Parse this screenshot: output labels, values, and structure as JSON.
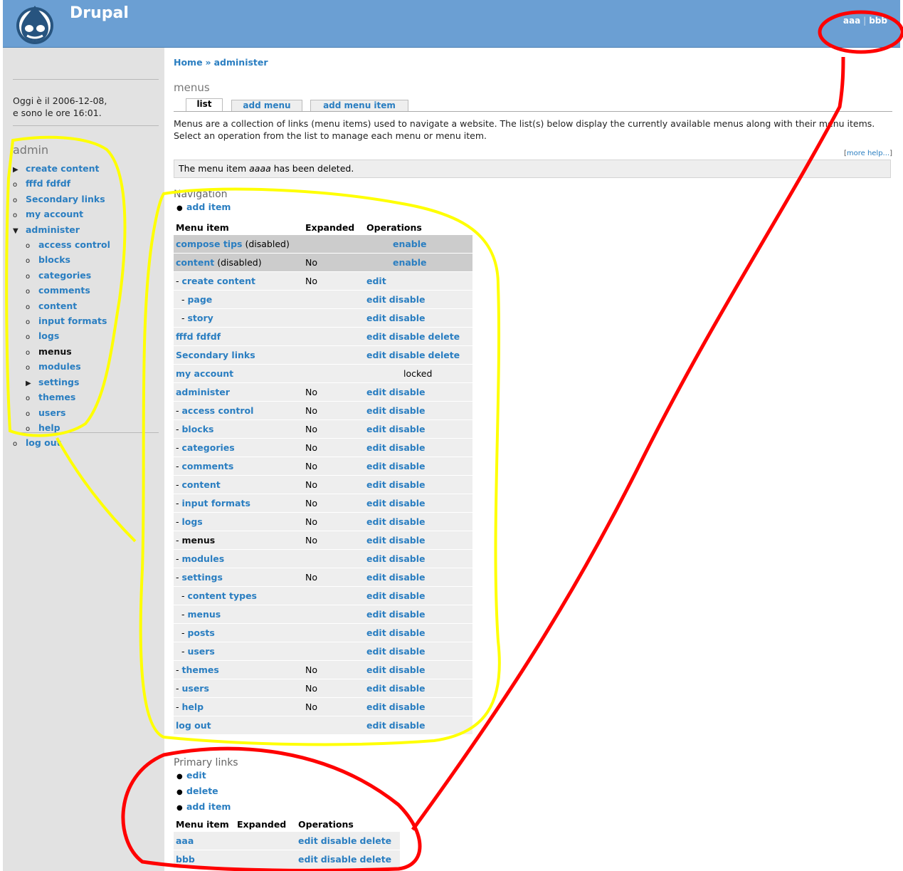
{
  "header": {
    "site_name": "Drupal",
    "secondary_links": [
      {
        "label": "aaa"
      },
      {
        "label": "bbb"
      }
    ],
    "logo_icon": "drupal-drop-logo-icon"
  },
  "sidebar": {
    "date_line1": "Oggi è il 2006-12-08,",
    "date_line2": "e sono le ore 16:01.",
    "user_title": "admin",
    "items": [
      {
        "label": "create content",
        "bullet": "▶",
        "level": 0
      },
      {
        "label": "fffd fdfdf",
        "bullet": "o",
        "level": 0
      },
      {
        "label": "Secondary links",
        "bullet": "o",
        "level": 0
      },
      {
        "label": "my account",
        "bullet": "o",
        "level": 0
      },
      {
        "label": "administer",
        "bullet": "▼",
        "level": 0
      },
      {
        "label": "access control",
        "bullet": "o",
        "level": 1
      },
      {
        "label": "blocks",
        "bullet": "o",
        "level": 1
      },
      {
        "label": "categories",
        "bullet": "o",
        "level": 1
      },
      {
        "label": "comments",
        "bullet": "o",
        "level": 1
      },
      {
        "label": "content",
        "bullet": "o",
        "level": 1
      },
      {
        "label": "input formats",
        "bullet": "o",
        "level": 1
      },
      {
        "label": "logs",
        "bullet": "o",
        "level": 1
      },
      {
        "label": "menus",
        "bullet": "o",
        "level": 1,
        "current": true
      },
      {
        "label": "modules",
        "bullet": "o",
        "level": 1
      },
      {
        "label": "settings",
        "bullet": "▶",
        "level": 1
      },
      {
        "label": "themes",
        "bullet": "o",
        "level": 1
      },
      {
        "label": "users",
        "bullet": "o",
        "level": 1
      },
      {
        "label": "help",
        "bullet": "o",
        "level": 1
      },
      {
        "label": "log out",
        "bullet": "o",
        "level": 0
      }
    ]
  },
  "main": {
    "breadcrumb": {
      "home": "Home",
      "sep": "»",
      "current": "administer"
    },
    "title": "menus",
    "tabs": [
      {
        "label": "list"
      },
      {
        "label": "add menu"
      },
      {
        "label": "add menu item"
      }
    ],
    "help_text": "Menus are a collection of links (menu items) used to navigate a website. The list(s) below display the currently available menus along with their menu items. Select an operation from the list to manage each menu or menu item.",
    "more_help": "more help...",
    "status_prefix": "The menu item ",
    "status_item": "aaaa",
    "status_suffix": " has been deleted."
  },
  "navigation": {
    "title": "Navigation",
    "ops": [
      "add item"
    ],
    "headers": [
      "Menu item",
      "Expanded",
      "Operations"
    ],
    "rows": [
      {
        "item": "compose tips",
        "suffix": " (disabled)",
        "expanded": "",
        "ops": [
          "enable"
        ],
        "disabled": true,
        "ops_offset": true
      },
      {
        "item": "content",
        "suffix": " (disabled)",
        "expanded": "No",
        "ops": [
          "enable"
        ],
        "disabled": true,
        "ops_offset": true
      },
      {
        "item": "create content",
        "prefix": "- ",
        "expanded": "No",
        "ops": [
          "edit"
        ]
      },
      {
        "item": "page",
        "prefix": "  - ",
        "expanded": "",
        "ops": [
          "edit",
          "disable"
        ]
      },
      {
        "item": "story",
        "prefix": "  - ",
        "expanded": "",
        "ops": [
          "edit",
          "disable"
        ]
      },
      {
        "item": "fffd fdfdf",
        "expanded": "",
        "ops": [
          "edit",
          "disable",
          "delete"
        ]
      },
      {
        "item": "Secondary links",
        "expanded": "",
        "ops": [
          "edit",
          "disable",
          "delete"
        ]
      },
      {
        "item": "my account",
        "expanded": "",
        "ops": [],
        "locked": "locked"
      },
      {
        "item": "administer",
        "expanded": "No",
        "ops": [
          "edit",
          "disable"
        ]
      },
      {
        "item": "access control",
        "prefix": "- ",
        "expanded": "No",
        "ops": [
          "edit",
          "disable"
        ]
      },
      {
        "item": "blocks",
        "prefix": "- ",
        "expanded": "No",
        "ops": [
          "edit",
          "disable"
        ]
      },
      {
        "item": "categories",
        "prefix": "- ",
        "expanded": "No",
        "ops": [
          "edit",
          "disable"
        ]
      },
      {
        "item": "comments",
        "prefix": "- ",
        "expanded": "No",
        "ops": [
          "edit",
          "disable"
        ]
      },
      {
        "item": "content",
        "prefix": "- ",
        "expanded": "No",
        "ops": [
          "edit",
          "disable"
        ]
      },
      {
        "item": "input formats",
        "prefix": "- ",
        "expanded": "No",
        "ops": [
          "edit",
          "disable"
        ]
      },
      {
        "item": "logs",
        "prefix": "- ",
        "expanded": "No",
        "ops": [
          "edit",
          "disable"
        ]
      },
      {
        "item": "menus",
        "prefix": "- ",
        "expanded": "No",
        "ops": [
          "edit",
          "disable"
        ],
        "current": true
      },
      {
        "item": "modules",
        "prefix": "- ",
        "expanded": "",
        "ops": [
          "edit",
          "disable"
        ]
      },
      {
        "item": "settings",
        "prefix": "- ",
        "expanded": "No",
        "ops": [
          "edit",
          "disable"
        ]
      },
      {
        "item": "content types",
        "prefix": "  - ",
        "expanded": "",
        "ops": [
          "edit",
          "disable"
        ]
      },
      {
        "item": "menus",
        "prefix": "  - ",
        "expanded": "",
        "ops": [
          "edit",
          "disable"
        ]
      },
      {
        "item": "posts",
        "prefix": "  - ",
        "expanded": "",
        "ops": [
          "edit",
          "disable"
        ]
      },
      {
        "item": "users",
        "prefix": "  - ",
        "expanded": "",
        "ops": [
          "edit",
          "disable"
        ]
      },
      {
        "item": "themes",
        "prefix": "- ",
        "expanded": "No",
        "ops": [
          "edit",
          "disable"
        ]
      },
      {
        "item": "users",
        "prefix": "- ",
        "expanded": "No",
        "ops": [
          "edit",
          "disable"
        ]
      },
      {
        "item": "help",
        "prefix": "- ",
        "expanded": "No",
        "ops": [
          "edit",
          "disable"
        ]
      },
      {
        "item": "log out",
        "expanded": "",
        "ops": [
          "edit",
          "disable"
        ]
      }
    ]
  },
  "primary": {
    "title": "Primary links",
    "ops": [
      "edit",
      "delete",
      "add item"
    ],
    "headers": [
      "Menu item",
      "Expanded",
      "Operations"
    ],
    "rows": [
      {
        "item": "aaa",
        "expanded": "",
        "ops": [
          "edit",
          "disable",
          "delete"
        ]
      },
      {
        "item": "bbb",
        "expanded": "",
        "ops": [
          "edit",
          "disable",
          "delete"
        ]
      }
    ]
  },
  "colors": {
    "header_bg": "#6b9fd3",
    "link": "#2a7ec1",
    "sidebar_bg": "#e2e2e2",
    "yellow_annotation": "#ffff00",
    "red_annotation": "#ff0000"
  }
}
